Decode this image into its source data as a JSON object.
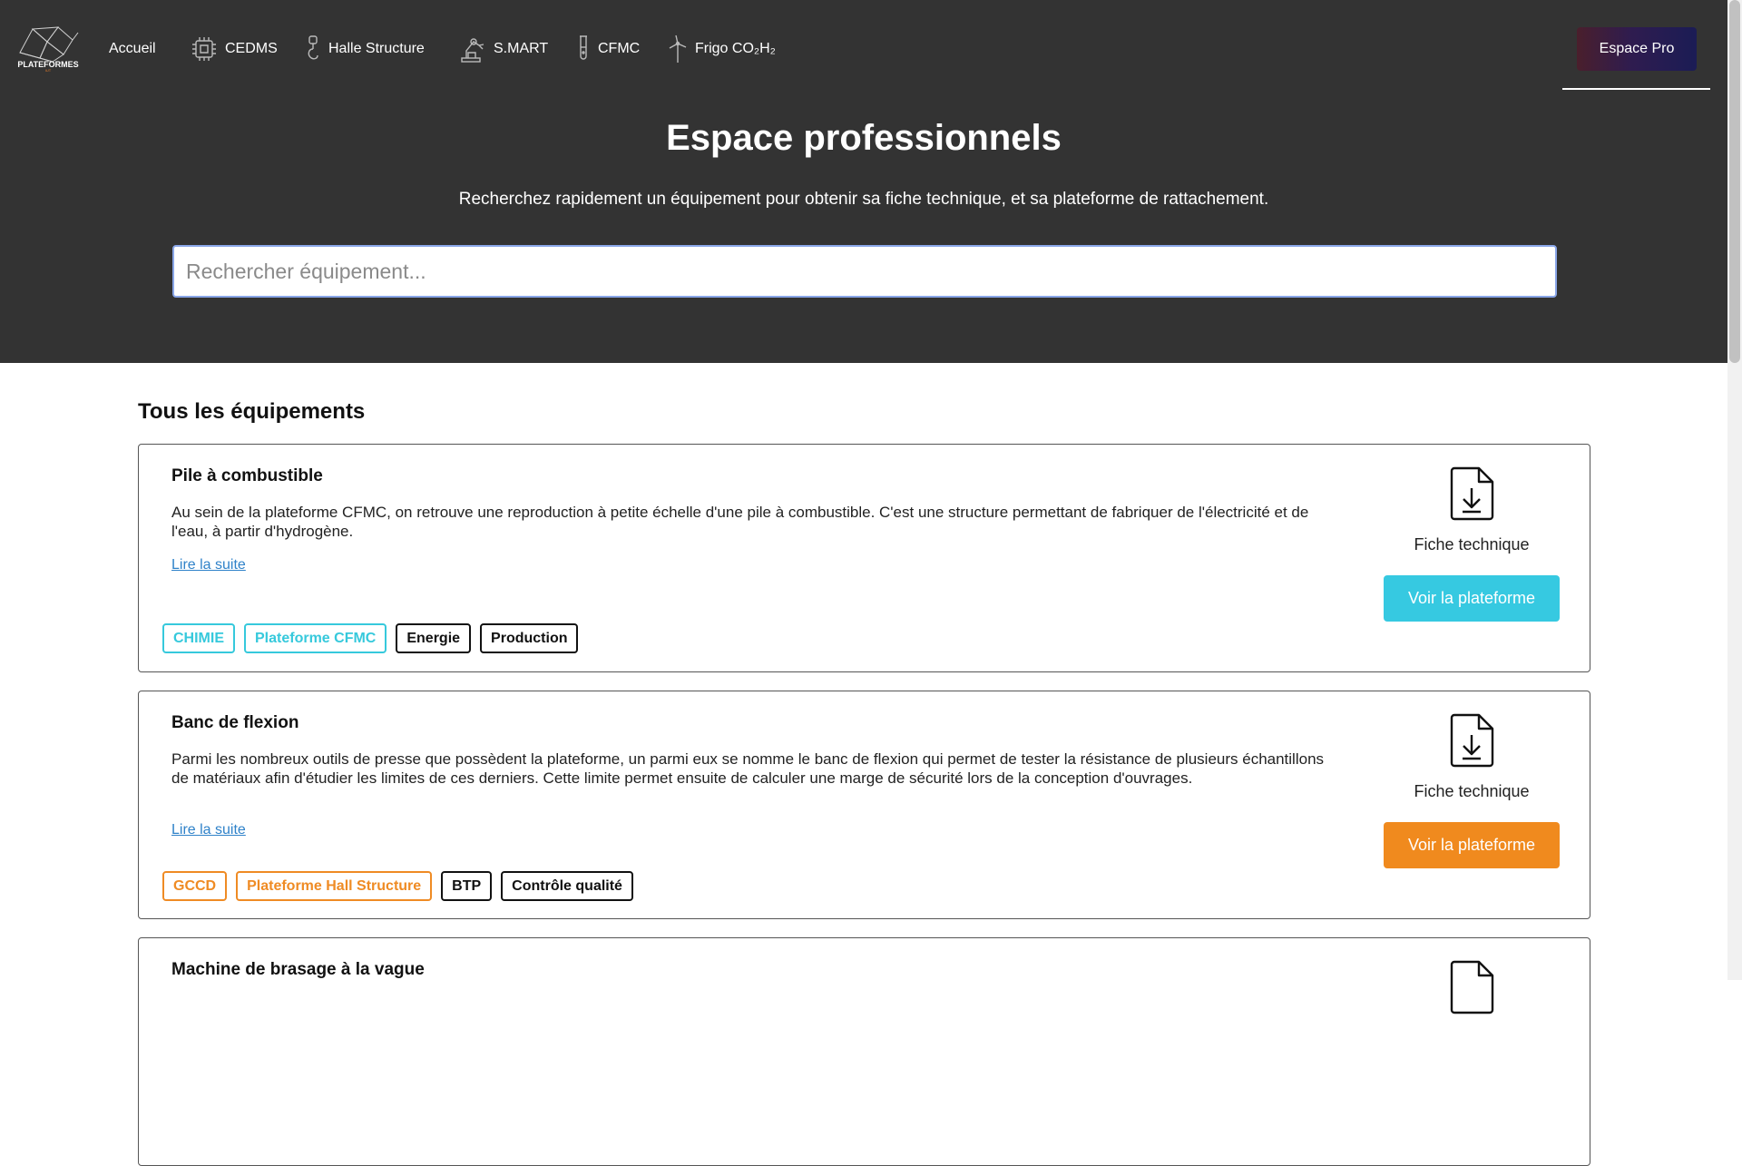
{
  "nav": {
    "logo_text": "PLATEFORMES IUT",
    "items": [
      {
        "label": "Accueil",
        "icon": ""
      },
      {
        "label": "CEDMS",
        "icon": "chip-icon"
      },
      {
        "label": "Halle Structure",
        "icon": "crane-hook-icon"
      },
      {
        "label": "S.MART",
        "icon": "robot-arm-icon"
      },
      {
        "label": "CFMC",
        "icon": "test-tube-icon"
      },
      {
        "label": "Frigo CO₂H₂",
        "icon": "wind-turbine-icon"
      }
    ],
    "cta_label": "Espace Pro"
  },
  "hero": {
    "title": "Espace professionnels",
    "subtitle": "Recherchez rapidement un équipement pour obtenir sa fiche technique, et sa plateforme de rattachement.",
    "search_placeholder": "Rechercher équipement..."
  },
  "section_title": "Tous les équipements",
  "equipments": [
    {
      "title": "Pile à combustible",
      "description": "Au sein de la plateforme CFMC, on retrouve une reproduction à petite échelle d'une pile à combustible. C'est une structure permettant de fabriquer de l'électricité et de l'eau, à partir d'hydrogène.",
      "read_more": "Lire la suite",
      "fiche_label": "Fiche technique",
      "cta_label": "Voir la plateforme",
      "accent": "#36c9e1",
      "tags": [
        "CHIMIE",
        "Plateforme CFMC",
        "Energie",
        "Production"
      ]
    },
    {
      "title": "Banc de flexion",
      "description": "Parmi les nombreux outils de presse que possèdent la plateforme, un parmi eux se nomme le banc de flexion qui permet de tester la résistance de plusieurs échantillons de matériaux afin d'étudier les limites de ces derniers. Cette limite permet ensuite de calculer une marge de sécurité lors de la conception d'ouvrages.",
      "read_more": "Lire la suite",
      "fiche_label": "Fiche technique",
      "cta_label": "Voir la plateforme",
      "accent": "#f08a1e",
      "tags": [
        "GCCD",
        "Plateforme Hall Structure",
        "BTP",
        "Contrôle qualité"
      ]
    },
    {
      "title": "Machine de brasage à la vague"
    }
  ]
}
